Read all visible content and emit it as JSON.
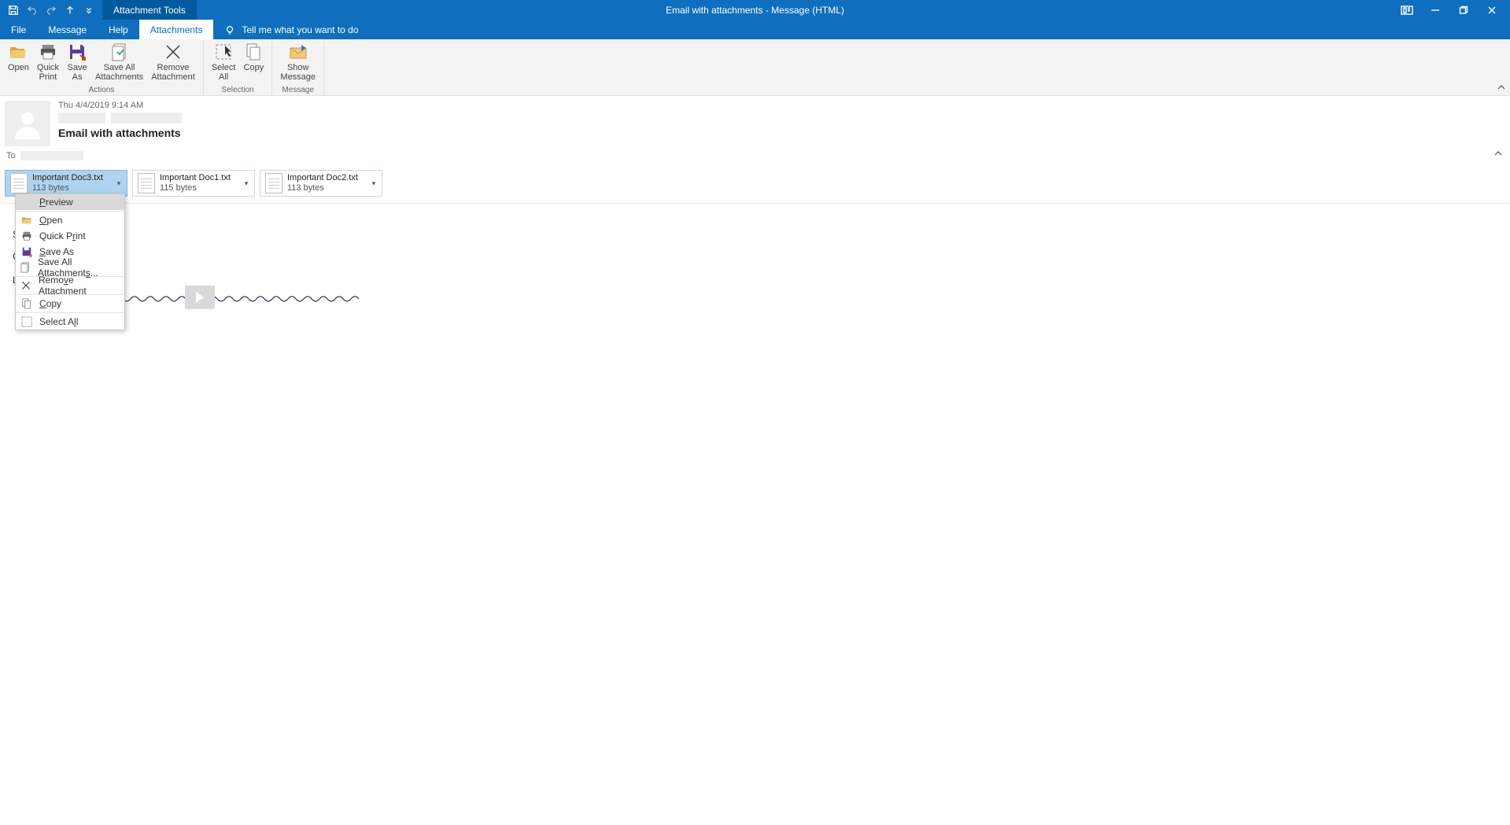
{
  "titlebar": {
    "tool_tab": "Attachment Tools",
    "window_title": "Email with attachments  -  Message (HTML)"
  },
  "tabs": {
    "file": "File",
    "message": "Message",
    "help": "Help",
    "attachments": "Attachments",
    "tell_me": "Tell me what you want to do"
  },
  "ribbon": {
    "open": "Open",
    "quick_print": "Quick\nPrint",
    "save_as": "Save\nAs",
    "save_all": "Save All\nAttachments",
    "remove": "Remove\nAttachment",
    "select_all": "Select\nAll",
    "copy": "Copy",
    "show_message": "Show\nMessage",
    "group_actions": "Actions",
    "group_selection": "Selection",
    "group_message": "Message"
  },
  "message": {
    "date": "Thu 4/4/2019 9:14 AM",
    "subject": "Email with attachments",
    "to_label": "To"
  },
  "attachments": [
    {
      "name": "Important Doc3.txt",
      "size": "113 bytes",
      "selected": true
    },
    {
      "name": "Important Doc1.txt",
      "size": "115 bytes",
      "selected": false
    },
    {
      "name": "Important Doc2.txt",
      "size": "113 bytes",
      "selected": false
    }
  ],
  "context_menu": {
    "preview": "Preview",
    "open": "Open",
    "quick_print": "Quick Print",
    "save_as": "Save As",
    "save_all": "Save All Attachments...",
    "remove": "Remove Attachment",
    "copy": "Copy",
    "select_all": "Select All"
  },
  "body_fragments": {
    "l1": "S",
    "l2": "C",
    "l3": "L"
  }
}
